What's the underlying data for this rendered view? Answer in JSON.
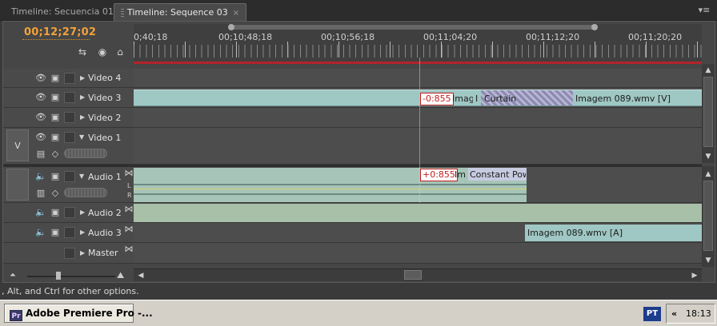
{
  "tabs": [
    {
      "label": "Timeline: Secuencia 01",
      "active": false
    },
    {
      "label": "Timeline: Sequence 03",
      "active": true,
      "close": "×"
    }
  ],
  "panel_menu": "▾≡",
  "timecode": "00;12;27;02",
  "ruler_labels": [
    "0;40;18",
    "00;10;48;18",
    "00;10;56;18",
    "00;11;04;20",
    "00;11;12;20",
    "00;11;20;20"
  ],
  "video_tracks": [
    {
      "name": "Video 4"
    },
    {
      "name": "Video 3"
    },
    {
      "name": "Video 2"
    },
    {
      "name": "Video 1",
      "target": "V"
    }
  ],
  "audio_tracks": [
    {
      "name": "Audio 1",
      "channels": [
        "L",
        "R"
      ]
    },
    {
      "name": "Audio 2"
    },
    {
      "name": "Audio 3"
    },
    {
      "name": "Master"
    }
  ],
  "clips": {
    "v3_badge": "-0:855",
    "v3_imag": "Imag",
    "v3_i": "I",
    "v3_curtain": "Curtain",
    "v3_main": "Imagem 089.wmv [V]",
    "a1_badge": "+0:855",
    "a1_im": "Im",
    "a1_cp": "Constant Powe",
    "a3_main": "Imagem 089.wmv [A]"
  },
  "status_text": ", Alt, and Ctrl for other options.",
  "taskbar": {
    "app_icon": "Pr",
    "app_label": "Adobe Premiere Pro -...",
    "lang": "PT",
    "tray_arrow": "«",
    "clock": "18:13"
  },
  "colors": {
    "timecode": "#f2a23a",
    "video_clip": "#9fc7c3",
    "audio_clip": "#a6c5b8",
    "transition": "#8d8bb0",
    "badge_red": "#c01e1e",
    "work_area": "#b3232a"
  },
  "icons": [
    "snap-icon",
    "marker-icon",
    "home-icon",
    "eye-icon",
    "film-icon",
    "speaker-icon",
    "expand-triangle-icon",
    "scroll-up-icon",
    "scroll-down-icon",
    "scroll-left-icon",
    "scroll-right-icon",
    "zoom-out-icon",
    "zoom-in-icon",
    "wrench-key-icon",
    "keyframe-icon"
  ]
}
